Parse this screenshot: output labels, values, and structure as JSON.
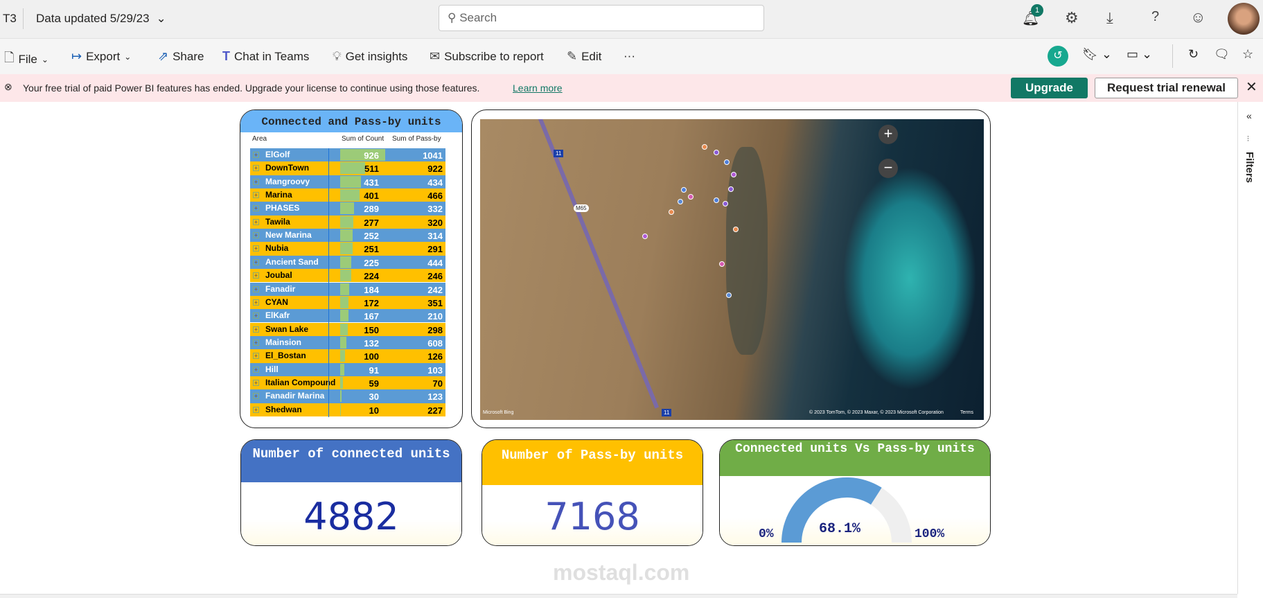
{
  "topbar": {
    "workspace": "T3",
    "data_updated": "Data updated 5/29/23",
    "search_placeholder": "Search",
    "notifications_count": "1"
  },
  "toolbar": {
    "file": "File",
    "export": "Export",
    "share": "Share",
    "chat": "Chat in Teams",
    "insights": "Get insights",
    "subscribe": "Subscribe to report",
    "edit": "Edit",
    "more": "···"
  },
  "banner": {
    "message": "Your free trial of paid Power BI features has ended. Upgrade your license to continue using those features.",
    "learn_more": "Learn more",
    "upgrade": "Upgrade",
    "request": "Request trial renewal"
  },
  "filters": {
    "label": "Filters"
  },
  "table": {
    "title": "Connected and Pass-by units",
    "headers": [
      "Area",
      "Sum of Count",
      "Sum of Pass-by"
    ],
    "rows": [
      [
        "ElGolf",
        926,
        1041
      ],
      [
        "DownTown",
        511,
        922
      ],
      [
        "Mangroovy",
        431,
        434
      ],
      [
        "Marina",
        401,
        466
      ],
      [
        "PHASES",
        289,
        332
      ],
      [
        "Tawila",
        277,
        320
      ],
      [
        "New Marina",
        252,
        314
      ],
      [
        "Nubia",
        251,
        291
      ],
      [
        "Ancient Sand",
        225,
        444
      ],
      [
        "Joubal",
        224,
        246
      ],
      [
        "Fanadir",
        184,
        242
      ],
      [
        "CYAN",
        172,
        351
      ],
      [
        "ElKafr",
        167,
        210
      ],
      [
        "Swan Lake",
        150,
        298
      ],
      [
        "Mainsion",
        132,
        608
      ],
      [
        "El_Bostan",
        100,
        126
      ],
      [
        "Hill",
        91,
        103
      ],
      [
        "Italian Compound",
        59,
        70
      ],
      [
        "Fanadir Marina",
        30,
        123
      ],
      [
        "Shedwan",
        10,
        227
      ]
    ]
  },
  "map": {
    "road1": "M65",
    "road2": "11",
    "road3": "11",
    "brand": "Microsoft Bing",
    "attribution": "© 2023 TomTom, © 2023 Maxar, © 2023 Microsoft Corporation",
    "terms": "Terms",
    "zoom_in": "+",
    "zoom_out": "−"
  },
  "kpi1": {
    "title": "Number of connected units",
    "value": "4882",
    "color": "#4472c4"
  },
  "kpi2": {
    "title": "Number of Pass-by units",
    "value": "7168",
    "color": "#ffc000"
  },
  "gauge": {
    "title": "Connected units Vs Pass-by units",
    "value": 68.1,
    "value_label": "68.1%",
    "min_label": "0%",
    "max_label": "100%",
    "color": "#70ad47"
  },
  "watermark": "mostaql.com",
  "colors": {
    "blue_row": "#5b9bd5",
    "yellow_row": "#ffc000",
    "bar": "#9ccb78",
    "teal": "#117865"
  }
}
